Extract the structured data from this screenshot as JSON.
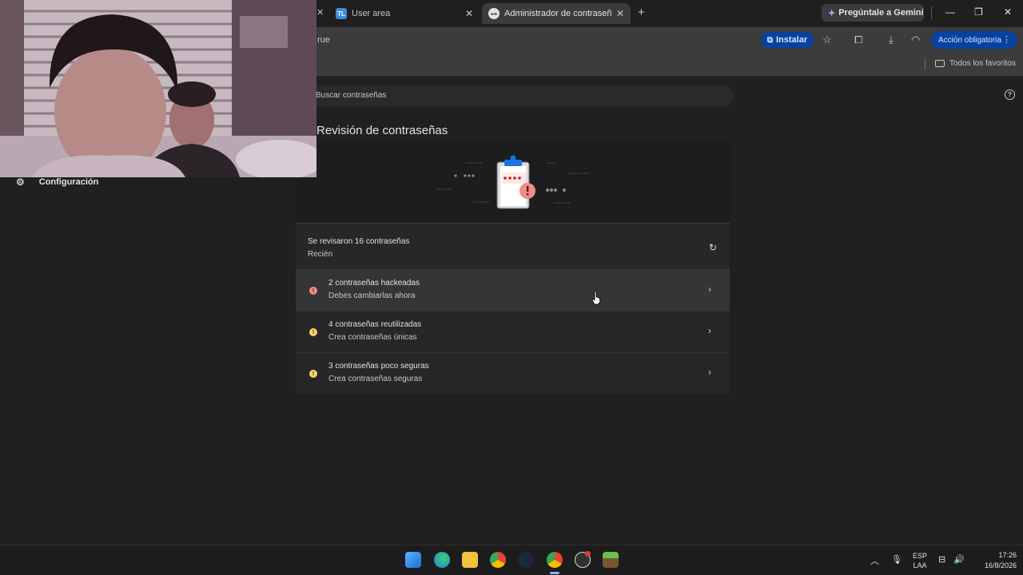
{
  "browser": {
    "tabs": [
      {
        "label": "User area",
        "favicon": "TL"
      },
      {
        "label": "Administrador de contraseñas de Google",
        "active": true
      }
    ],
    "gemini_label": "Pregúntale a Gemini",
    "url_fragment": "rue",
    "install_label": "Instalar",
    "action_label": "Acción obligatoria",
    "bookmarks_all_label": "Todos los favoritos"
  },
  "page": {
    "search_placeholder": "Buscar contraseñas",
    "title": "Revisión de contraseñas",
    "settings_label": "Configuración",
    "checkup": {
      "summary": "Se revisaron 16 contraseñas",
      "time": "Recién"
    },
    "issues": [
      {
        "title": "2 contraseñas hackeadas",
        "subtitle": "Debes cambiarlas ahora",
        "severity": "red"
      },
      {
        "title": "4 contraseñas reutilizadas",
        "subtitle": "Crea contraseñas únicas",
        "severity": "yellow"
      },
      {
        "title": "3 contraseñas poco seguras",
        "subtitle": "Crea contraseñas seguras",
        "severity": "yellow"
      }
    ]
  },
  "taskbar": {
    "lang_line1": "ESP",
    "lang_line2": "LAA",
    "time": "17:26",
    "date": "16/8/2026",
    "apps": [
      "windows-start",
      "edge",
      "file-explorer",
      "chrome",
      "steam",
      "chrome-active",
      "obs",
      "minecraft"
    ]
  },
  "colors": {
    "accent_blue": "#0842a0",
    "danger": "#f28b82",
    "warning": "#fdd663"
  }
}
